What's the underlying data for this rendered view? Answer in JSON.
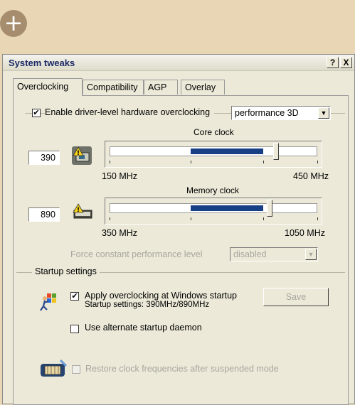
{
  "window": {
    "title": "System tweaks",
    "help_btn": "?",
    "close_btn": "X"
  },
  "tabs": [
    {
      "label": "Overclocking"
    },
    {
      "label": "Compatibility"
    },
    {
      "label": "AGP"
    },
    {
      "label": "Overlay"
    }
  ],
  "overclocking": {
    "enable_label": "Enable driver-level hardware overclocking",
    "enable_checked": "✔",
    "mode_value": "performance 3D",
    "core": {
      "title": "Core clock",
      "value": "390",
      "min_label": "150 MHz",
      "max_label": "450 MHz",
      "range_start": 0.39,
      "range_end": 0.74,
      "thumb": 0.8
    },
    "memory": {
      "title": "Memory clock",
      "value": "890",
      "min_label": "350 MHz",
      "max_label": "1050 MHz",
      "range_start": 0.39,
      "range_end": 0.74,
      "thumb": 0.77
    },
    "force_label": "Force constant performance level",
    "force_value": "disabled"
  },
  "startup": {
    "group_label": "Startup settings",
    "apply_label": "Apply overclocking at Windows startup",
    "apply_checked": "✔",
    "apply_detail": "Startup settings: 390MHz/890MHz",
    "save_label": "Save",
    "alt_daemon_label": "Use alternate startup daemon"
  },
  "restore_label": "Restore clock frequencies after suspended mode",
  "badge": "+"
}
